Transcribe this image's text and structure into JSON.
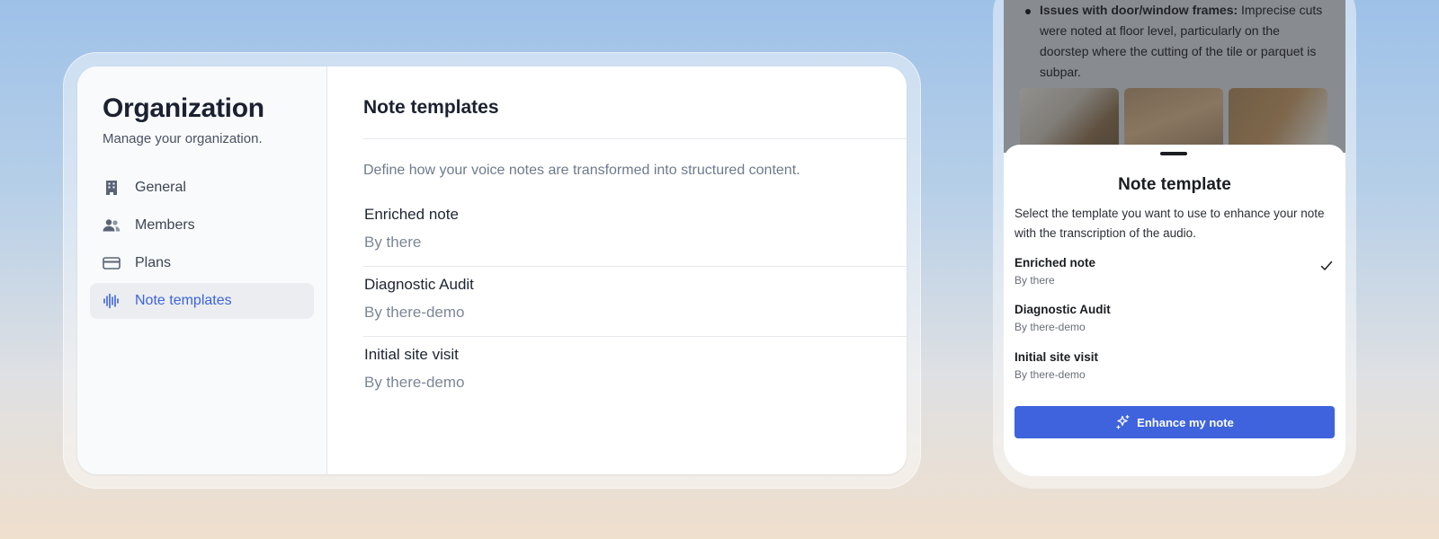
{
  "organization": {
    "title": "Organization",
    "subtitle": "Manage your organization.",
    "nav": [
      {
        "label": "General",
        "icon": "building-icon",
        "active": false
      },
      {
        "label": "Members",
        "icon": "users-icon",
        "active": false
      },
      {
        "label": "Plans",
        "icon": "credit-card-icon",
        "active": false
      },
      {
        "label": "Note templates",
        "icon": "audio-waveform-icon",
        "active": true
      }
    ]
  },
  "main": {
    "title": "Note templates",
    "description": "Define how your voice notes are transformed into structured content.",
    "templates": [
      {
        "name": "Enriched note",
        "author": "By there"
      },
      {
        "name": "Diagnostic Audit",
        "author": "By there-demo"
      },
      {
        "name": "Initial site visit",
        "author": "By there-demo"
      }
    ]
  },
  "phone": {
    "background_note": {
      "bold": "Issues with door/window frames:",
      "text": " Imprecise cuts were noted at floor level, particularly on the doorstep where the cutting of the tile or parquet is subpar."
    },
    "sheet": {
      "title": "Note template",
      "description": "Select the template you want to use to enhance your note with the transcription of the audio.",
      "options": [
        {
          "name": "Enriched note",
          "author": "By there",
          "selected": true
        },
        {
          "name": "Diagnostic Audit",
          "author": "By there-demo",
          "selected": false
        },
        {
          "name": "Initial site visit",
          "author": "By there-demo",
          "selected": false
        }
      ],
      "button_label": "Enhance my note"
    }
  },
  "colors": {
    "accent": "#3e63dd",
    "active_nav_bg": "#ebedf0"
  }
}
